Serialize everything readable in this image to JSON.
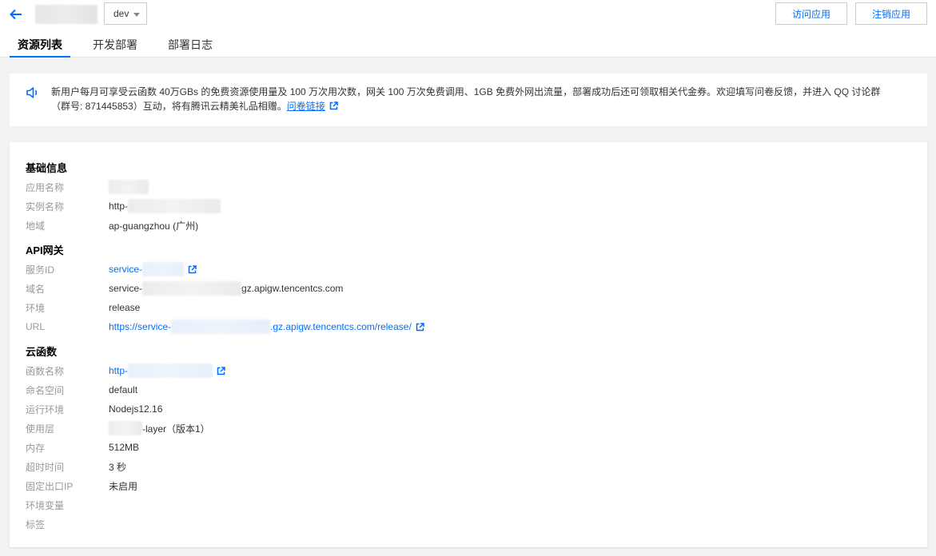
{
  "header": {
    "env_selected": "dev",
    "visit_label": "访问应用",
    "unregister_label": "注销应用"
  },
  "tabs": [
    {
      "label": "资源列表",
      "active": true
    },
    {
      "label": "开发部署",
      "active": false
    },
    {
      "label": "部署日志",
      "active": false
    }
  ],
  "notice": {
    "line1": "新用户每月可享受云函数 40万GBs 的免费资源使用量及 100 万次用次数，网关 100 万次免费调用、1GB 免费外网出流量，部署成功后还可领取相关代金券。欢迎填写问卷反馈，并进入 QQ 讨论群",
    "line2": "（群号: 871445853）互动，将有腾讯云精美礼品相赠。",
    "link": "问卷链接"
  },
  "basic": {
    "title": "基础信息",
    "app_name_label": "应用名称",
    "instance_label": "实例名称",
    "instance_value": "http-",
    "region_label": "地域",
    "region_value": "ap-guangzhou (广州)"
  },
  "api": {
    "title": "API网关",
    "service_id_label": "服务ID",
    "service_id_value": "service-",
    "domain_label": "域名",
    "domain_prefix": "service-",
    "domain_suffix": "gz.apigw.tencentcs.com",
    "env_label": "环境",
    "env_value": "release",
    "url_label": "URL",
    "url_prefix": "https://service-",
    "url_suffix": ".gz.apigw.tencentcs.com/release/"
  },
  "scf": {
    "title": "云函数",
    "func_name_label": "函数名称",
    "func_name_value": "http-",
    "namespace_label": "命名空间",
    "namespace_value": "default",
    "runtime_label": "运行环境",
    "runtime_value": "Nodejs12.16",
    "layer_label": "使用层",
    "layer_value": "-layer（版本1）",
    "memory_label": "内存",
    "memory_value": "512MB",
    "timeout_label": "超时时间",
    "timeout_value": "3 秒",
    "fixed_ip_label": "固定出口IP",
    "fixed_ip_value": "未启用",
    "env_vars_label": "环境变量",
    "tags_label": "标签"
  },
  "colors": {
    "accent": "#006eff",
    "label": "#999999",
    "background": "#f2f2f2"
  }
}
